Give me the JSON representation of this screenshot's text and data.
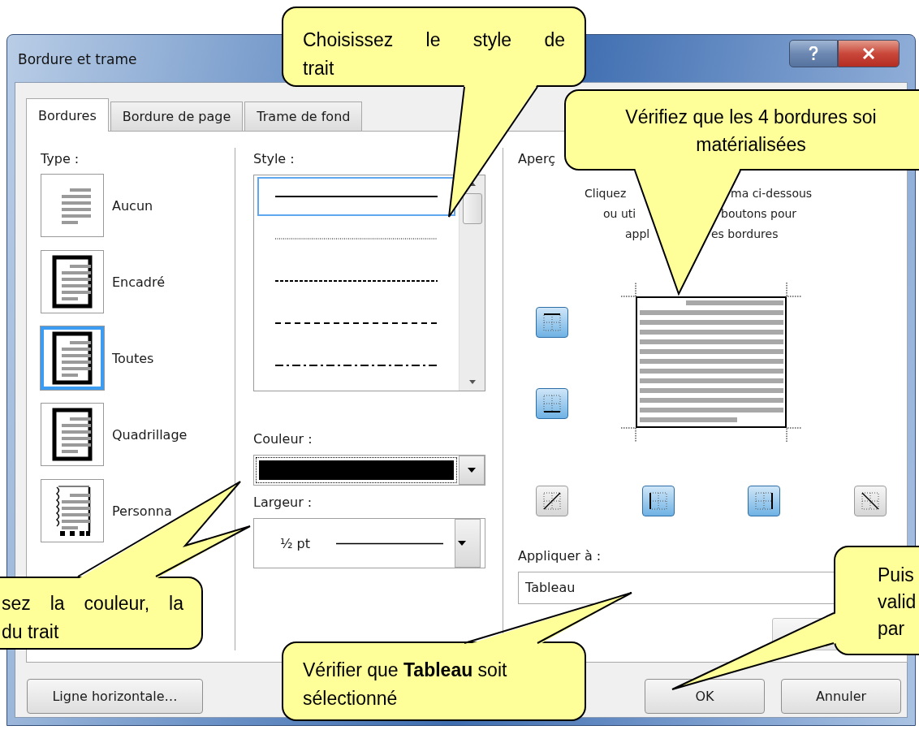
{
  "window": {
    "title": "Bordure et trame"
  },
  "tabs": [
    {
      "label": "Bordures",
      "selected": true
    },
    {
      "label": "Bordure de page",
      "selected": false
    },
    {
      "label": "Trame de fond",
      "selected": false
    }
  ],
  "type_section": {
    "label": "Type :",
    "options": [
      {
        "label": "Aucun",
        "kind": "none",
        "selected": false
      },
      {
        "label": "Encadré",
        "kind": "box",
        "selected": false
      },
      {
        "label": "Toutes",
        "kind": "all",
        "selected": true
      },
      {
        "label": "Quadrillage",
        "kind": "grid",
        "selected": false
      },
      {
        "label": "Personna",
        "kind": "custom",
        "selected": false
      }
    ]
  },
  "style_section": {
    "label": "Style :",
    "line_styles": [
      {
        "kind": "solid",
        "selected": true
      },
      {
        "kind": "dotted",
        "selected": false
      },
      {
        "kind": "dashed-fine",
        "selected": false
      },
      {
        "kind": "dashed",
        "selected": false
      },
      {
        "kind": "dash-dot",
        "selected": false
      }
    ]
  },
  "color_field": {
    "label": "Couleur :",
    "color": "#000000"
  },
  "width_field": {
    "label": "Largeur :",
    "value": "½ pt"
  },
  "preview": {
    "label": "Aperç",
    "instruction_lines": [
      [
        "Cliquez",
        "ma ci-dessous"
      ],
      [
        "ou uti",
        "boutons pour"
      ],
      [
        "appl",
        "es bordures"
      ]
    ],
    "border_buttons": [
      {
        "kind": "top",
        "on": true
      },
      {
        "kind": "bottom",
        "on": true
      },
      {
        "kind": "diagonal-up",
        "on": false
      },
      {
        "kind": "left",
        "on": true
      },
      {
        "kind": "right",
        "on": true
      },
      {
        "kind": "diagonal-down",
        "on": false
      }
    ]
  },
  "apply_to": {
    "label": "Appliquer à :",
    "value": "Tableau"
  },
  "buttons": [
    {
      "label": "Ligne horizontale…",
      "kind": "left"
    },
    {
      "label": "OK",
      "kind": "right"
    },
    {
      "label": "Annuler",
      "kind": "right"
    }
  ],
  "callouts": [
    {
      "kind": "style",
      "lines": [
        "Choisissez le style de",
        "trait"
      ]
    },
    {
      "kind": "borders",
      "lines": [
        "Vérifiez que les 4 bordures soi",
        "matérialisées"
      ]
    },
    {
      "kind": "color-width",
      "lines": [
        "sez la couleur, la",
        "du trait"
      ]
    },
    {
      "kind": "apply",
      "lines": [
        "Vérifier que **Tableau** soit",
        "sélectionné"
      ]
    },
    {
      "kind": "validate",
      "lines": [
        "Puis",
        "valid",
        "par"
      ]
    }
  ]
}
